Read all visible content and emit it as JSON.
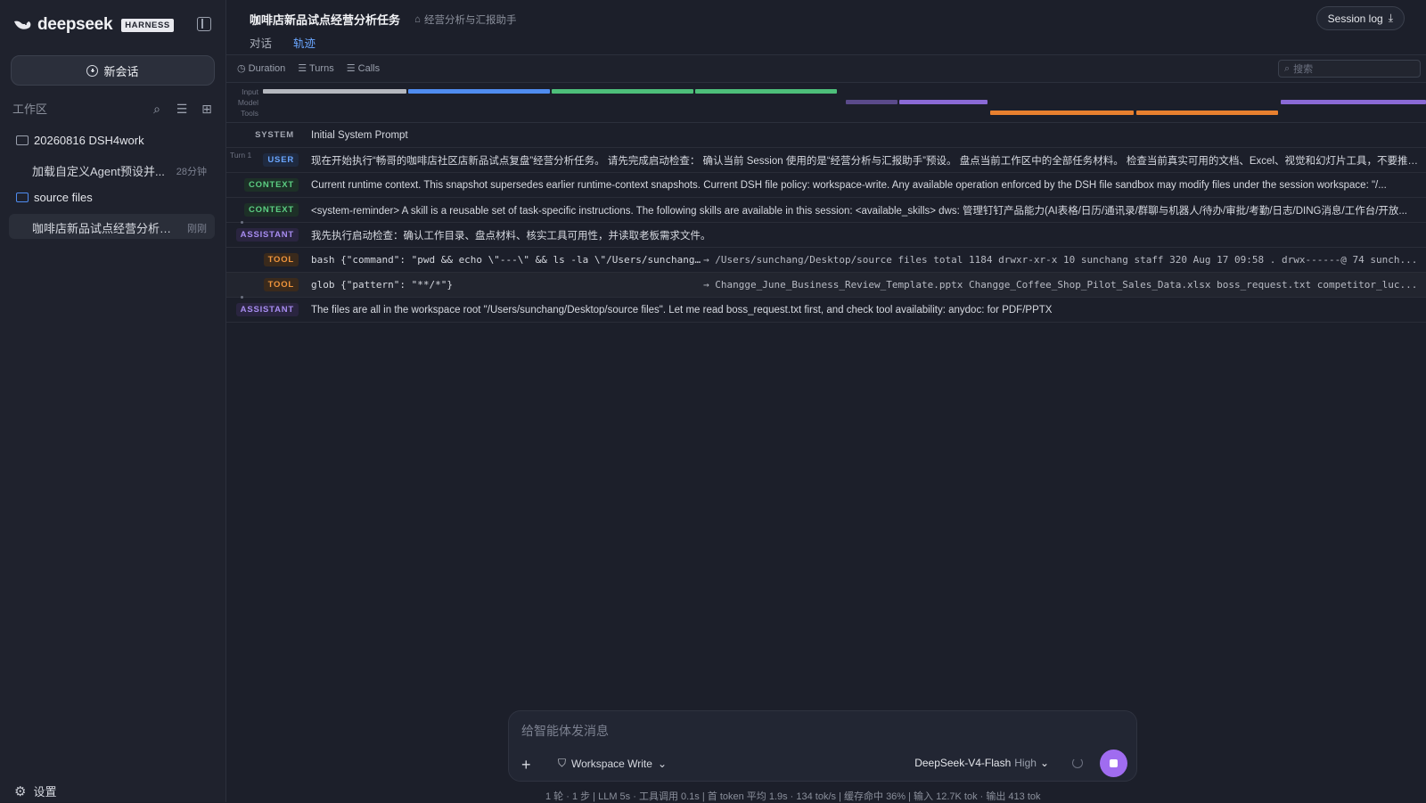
{
  "sidebar": {
    "brand": "deepseek",
    "badge": "HARNESS",
    "new_chat": "新会话",
    "workspace_label": "工作区",
    "items": [
      {
        "label": "20260816 DSH4work"
      },
      {
        "title": "加载自定义Agent预设并...",
        "time": "28分钟"
      },
      {
        "label": "source files"
      },
      {
        "title": "咖啡店新品试点经营分析任务",
        "time": "刚刚"
      }
    ],
    "settings": "设置"
  },
  "header": {
    "title": "咖啡店新品试点经营分析任务",
    "agent": "经营分析与汇报助手",
    "tabs": [
      "对话",
      "轨迹"
    ],
    "session_log": "Session log"
  },
  "metrics": {
    "tabs": [
      "Duration",
      "Turns",
      "Calls"
    ],
    "search_placeholder": "搜索"
  },
  "timeline": {
    "labels": [
      "Input",
      "Model",
      "Tools"
    ],
    "colors": {
      "input_gray": "#b5b8bf",
      "input_blue": "#4f8cf0",
      "input_green": "#4dbf7a",
      "model": "#8a6ad6",
      "tools": "#e8802f"
    }
  },
  "trace": {
    "turn_label": "Turn 1",
    "rows": [
      {
        "role": "SYSTEM",
        "text": "Initial System Prompt"
      },
      {
        "role": "USER",
        "text": "现在开始执行“畅哥的咖啡店社区店新品试点复盘”经营分析任务。 请先完成启动检查： 确认当前 Session 使用的是“经营分析与汇报助手”预设。 盘点当前工作区中的全部任务材料。 检查当前真实可用的文档、Excel、视觉和幻灯片工具，不要推测或虚"
      },
      {
        "role": "CONTEXT",
        "text": "Current runtime context. This snapshot supersedes earlier runtime-context snapshots. Current DSH file policy: workspace-write. Any available operation enforced by the DSH file sandbox may modify files under the session workspace: \"/..."
      },
      {
        "role": "CONTEXT",
        "text": "<system-reminder> A skill is a reusable set of task-specific instructions. The following skills are available in this session: <available_skills> dws: 管理钉钉产品能力(AI表格/日历/通讯录/群聊与机器人/待办/审批/考勤/日志/DING消息/工作台/开放..."
      },
      {
        "role": "ASSISTANT",
        "text": "我先执行启动检查：确认工作目录、盘点材料、核实工具可用性，并读取老板需求文件。"
      },
      {
        "role": "TOOL",
        "cmd": "bash {\"command\": \"pwd && echo \\\"---\\\" && ls -la \\\"/Users/sunchang/De...",
        "out": "→ /Users/sunchang/Desktop/source files total 1184 drwxr-xr-x 10 sunchang staff 320 Aug 17 09:58 . drwx------@ 74 sunch..."
      },
      {
        "role": "TOOL",
        "cmd": "glob {\"pattern\": \"**/*\"}",
        "out": "→ Changge_June_Business_Review_Template.pptx Changge_Coffee_Shop_Pilot_Sales_Data.xlsx boss_request.txt competitor_luc..."
      },
      {
        "role": "ASSISTANT",
        "text": "The files are all in the workspace root \"/Users/sunchang/Desktop/source files\". Let me read boss_request.txt first, and check tool availability: anydoc: for PDF/PPTX"
      }
    ]
  },
  "composer": {
    "placeholder": "给智能体发消息",
    "workspace_mode": "Workspace Write",
    "model": "DeepSeek-V4-Flash",
    "level": "High",
    "accent": "#a06cf0"
  },
  "status_bar": "1 轮 · 1 步   |   LLM 5s · 工具调用 0.1s   |   首 token 平均 1.9s · 134 tok/s   |   缓存命中 36%   |   输入 12.7K tok · 输出 413 tok"
}
